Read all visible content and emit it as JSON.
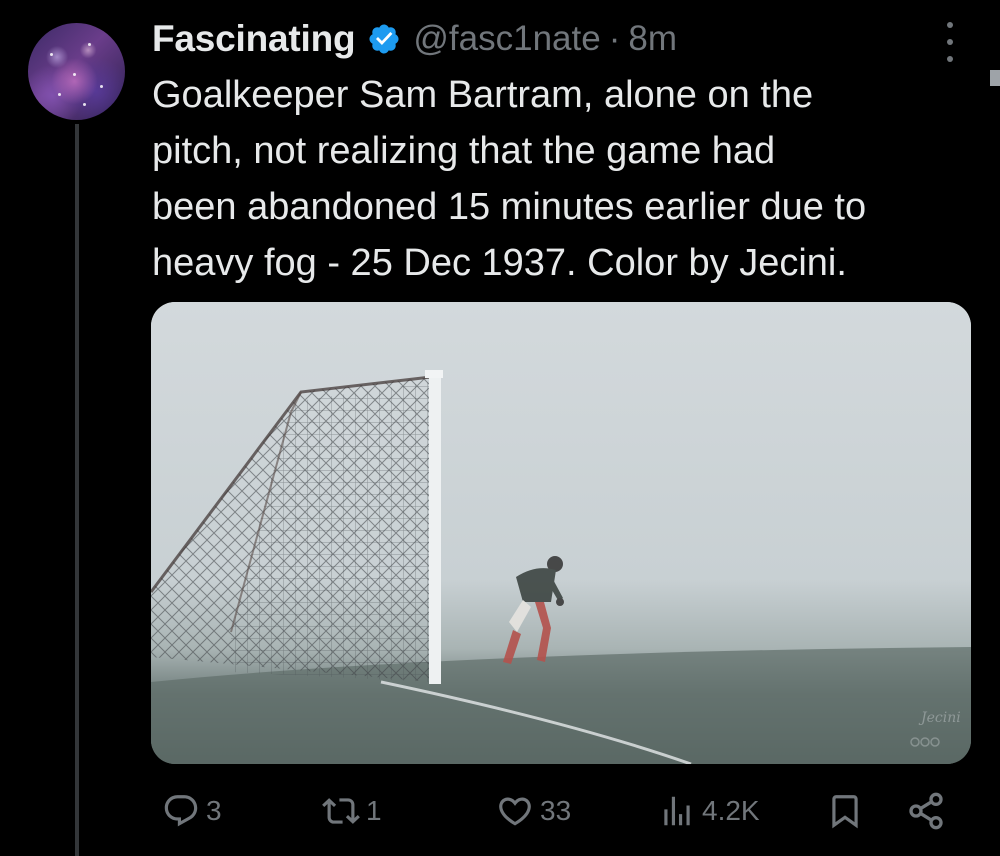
{
  "tweet": {
    "display_name": "Fascinating",
    "handle": "@fasc1nate",
    "separator": "·",
    "time": "8m",
    "text_lines": [
      "Goalkeeper Sam Bartram, alone on the",
      "pitch, not realizing that the game had",
      "been abandoned 15 minutes earlier due to",
      "heavy fog - 25 Dec 1937. Color by Jecini."
    ],
    "verified_icon": "verified-badge-icon",
    "verified_color": "#1d9bf0"
  },
  "actions": {
    "reply_count": "3",
    "retweet_count": "1",
    "like_count": "33",
    "view_count": "4.2K"
  },
  "icons": [
    "avatar",
    "verified-badge-icon",
    "more-icon",
    "reply-icon",
    "retweet-icon",
    "like-icon",
    "views-icon",
    "bookmark-icon",
    "share-icon"
  ],
  "colors": {
    "background": "#000000",
    "text": "#e7e9ea",
    "secondary": "#71767b",
    "thread_line": "#333639"
  }
}
